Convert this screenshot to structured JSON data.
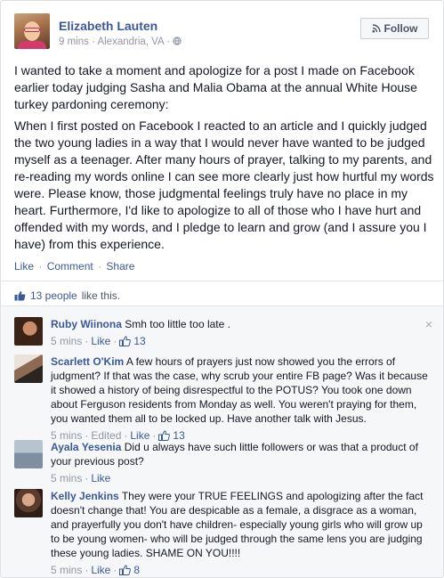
{
  "post": {
    "author": "Elizabeth Lauten",
    "meta": "9 mins · Alexandria, VA · ",
    "privacy_icon": "globe-icon",
    "follow_label": "Follow",
    "paragraph1": "I wanted to take a moment and apologize for a post I made on Facebook earlier today judging Sasha and Malia Obama at the annual White House turkey pardoning ceremony:",
    "paragraph2": "When I first posted on Facebook I reacted to an article and I quickly judged the two young ladies in a way that I would never have wanted to be judged myself as a teenager. After many hours of prayer, talking to my parents, and re-reading my words online I can see more clearly just how hurtful my words were. Please know, those judgmental feelings truly have no place in my heart. Furthermore, I'd like to apologize to all of those who I have hurt and offended with my words, and I pledge to learn and grow (and I assure you I have) from this experience.",
    "actions": {
      "like": "Like",
      "comment": "Comment",
      "share": "Share",
      "sep": "·"
    },
    "likes": {
      "link": "13 people",
      "text": "like this."
    }
  },
  "comments": [
    {
      "name": "Ruby Wiinona",
      "text": "Smh too little too late .",
      "time": "5 mins",
      "like": "Like",
      "count": "13",
      "edited": ""
    },
    {
      "name": "Scarlett O'Kim",
      "text": "A few hours of prayers just now showed you the errors of judgment? If that was the case, why scrub your entire FB page? Was it because it showed a history of being disrespectful to the POTUS? You took one down about Ferguson residents from Monday as well. You weren't praying for them, you wanted them all to be locked up. Have another talk with Jesus.",
      "time": "5 mins",
      "like": "Like",
      "count": "13",
      "edited": "Edited"
    },
    {
      "name": "Ayala Yesenia",
      "text": "Did u always have such little followers or was that a product of your previous post?",
      "time": "5 mins",
      "like": "Like",
      "count": "",
      "edited": ""
    },
    {
      "name": "Kelly Jenkins",
      "text": "They were your TRUE FEELINGS and apologizing after the fact doesn't change that! You are despicable as a female, a disgrace as a woman, and prayerfully you don't have children- especially young girls who will grow up to be young women- who will be judged through the same lens you are judging these young ladies. SHAME ON YOU!!!!",
      "time": "5 mins",
      "like": "Like",
      "count": "8",
      "edited": ""
    }
  ],
  "icons": {
    "close": "×",
    "follow_icon": "rss-icon",
    "thumb": "thumbs-up-icon"
  },
  "colors": {
    "link": "#3b5998",
    "meta": "#9197a3",
    "comments_bg": "#f6f7f9"
  }
}
